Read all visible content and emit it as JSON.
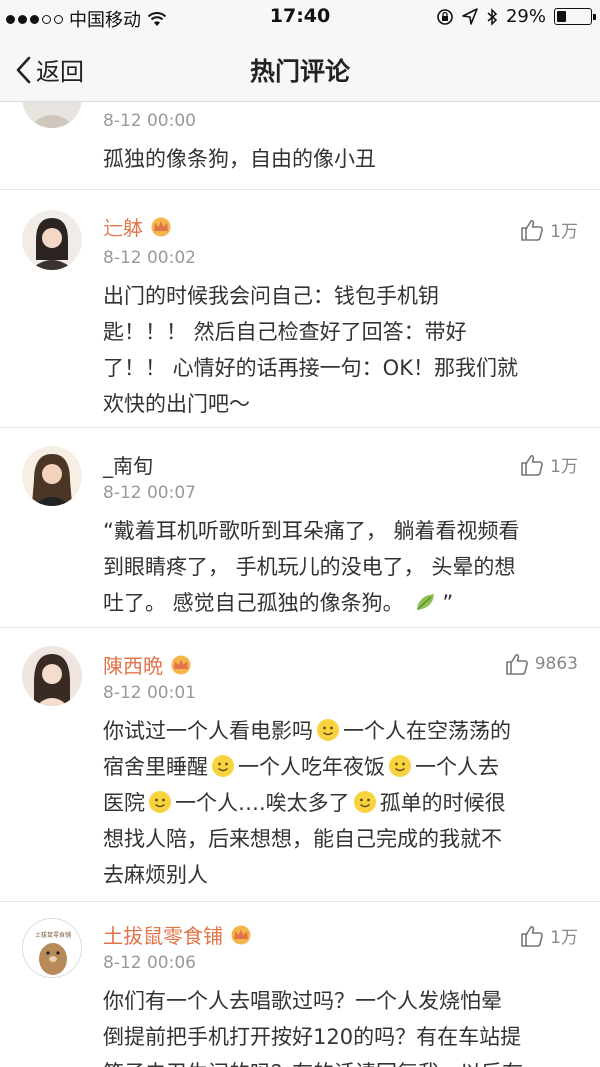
{
  "status_bar": {
    "carrier": "中国移动",
    "time": "17:40",
    "battery": "29%",
    "battery_level": 0.29,
    "icons": [
      "signal-dots-icon",
      "wifi-icon",
      "lock-rotation-icon",
      "location-arrow-icon",
      "bluetooth-icon",
      "battery-icon"
    ]
  },
  "nav": {
    "back_label": "返回",
    "title": "热门评论"
  },
  "colors": {
    "username": "#e0744a",
    "timestamp": "#999999",
    "text": "#333333",
    "crown": "#f4b64a"
  },
  "comments": [
    {
      "username": "",
      "time": "8-12 00:00",
      "likes": "",
      "text": "孤独的像条狗，自由的像小丑"
    },
    {
      "username": "辷躰",
      "time": "8-12 00:02",
      "likes": "1万",
      "text_lines": [
        "出门的时候我会问自己：钱包手机钥",
        "匙！！！ 然后自己检查好了回答：带好",
        "了！！ 心情好的话再接一句：OK！那我们就",
        "欢快的出门吧～"
      ]
    },
    {
      "username": "_南旬",
      "time": "8-12 00:07",
      "likes": "1万",
      "text_lines": [
        "“戴着耳机听歌听到耳朵痛了， 躺着看视频看",
        "到眼睛疼了， 手机玩儿的没电了， 头晕的想",
        "吐了。 感觉自己孤独的像条狗。",
        "”"
      ]
    },
    {
      "username": "陳西晩",
      "time": "8-12 00:01",
      "likes": "9863",
      "segments": [
        "你试过一个人看电影吗",
        "一个人在空荡荡的",
        "宿舍里睡醒",
        "一个人吃年夜饭",
        "一个人去",
        "医院",
        "一个人….唉太多了",
        "孤单的时候很",
        "想找人陪，后来想想，能自己完成的我就不",
        "去麻烦别人"
      ]
    },
    {
      "username": "土拔鼠零食铺",
      "time": "8-12 00:06",
      "likes": "1万",
      "text_lines": [
        "你们有一个人去唱歌过吗？一个人发烧怕晕",
        "倒提前把手机打开按好120的吗？有在车站提",
        "箱子去卫生间的吗？有的话请回复我，以后有"
      ]
    }
  ]
}
